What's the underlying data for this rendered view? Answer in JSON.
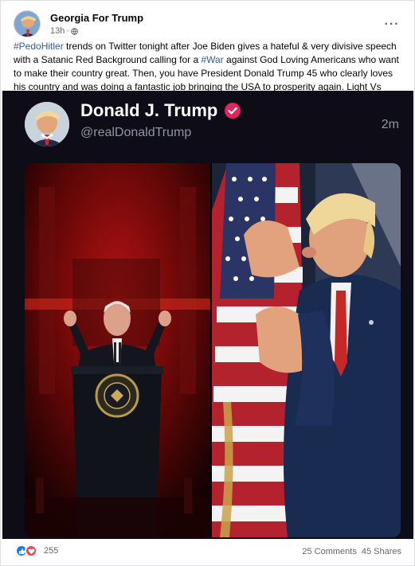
{
  "post": {
    "page_name": "Georgia For Trump",
    "time": "13h",
    "privacy_separator": "·",
    "more_label": "···",
    "caption": {
      "tag1": "#PedoHitler",
      "text1": " trends on Twitter tonight after Joe Biden gives a hateful & very divisive speech with a Satanic Red Background calling for a ",
      "tag2": "#War",
      "text2": " against God Loving Americans who want to make their country great. Then, you have President Donald Trump 45 who clearly loves his country and was doing a fantastic job bringing the USA to prosperity again. Light Vs Dark - GOD WINS!!!"
    }
  },
  "tweet": {
    "name": "Donald J. Trump",
    "handle": "@realDonaldTrump",
    "time": "2m"
  },
  "footer": {
    "reaction_count": "255",
    "comments": "25 Comments",
    "shares": "45 Shares"
  },
  "colors": {
    "link": "#385898",
    "like": "#1877f2",
    "love": "#f33e58",
    "verified": "#e0245e",
    "tweet_bg": "#0d0c17"
  },
  "icons": [
    "globe-icon",
    "more-options-icon",
    "verified-badge-icon",
    "like-reaction-icon",
    "love-reaction-icon"
  ]
}
